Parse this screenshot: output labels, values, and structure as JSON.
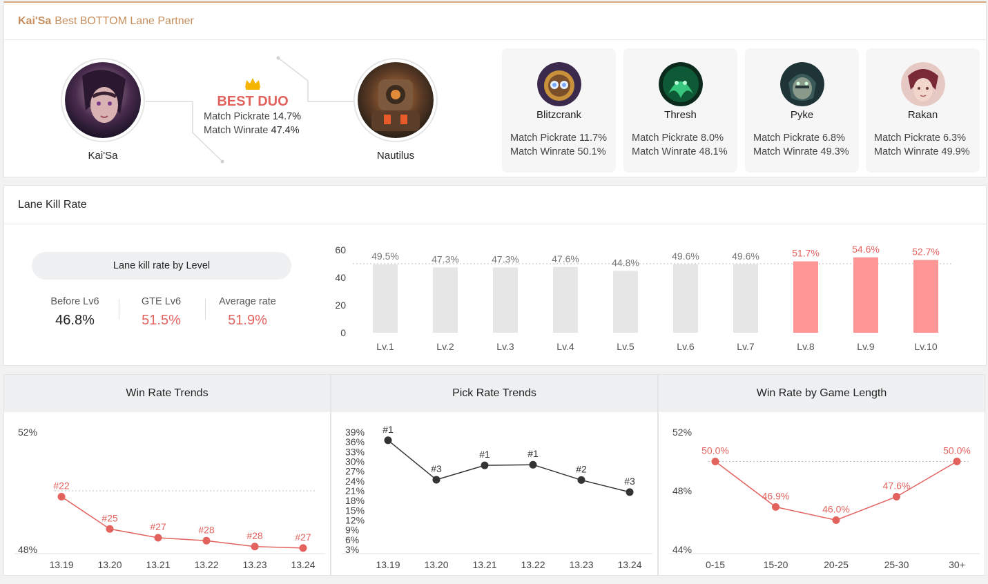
{
  "duo": {
    "title_champion": "Kai'Sa",
    "title_rest": "Best BOTTOM Lane Partner",
    "champion": "Kai'Sa",
    "partner": "Nautilus",
    "best_label": "BEST DUO",
    "pick_label": "Match Pickrate",
    "pick_value": "14.7%",
    "win_label": "Match Winrate",
    "win_value": "47.4%",
    "others": [
      {
        "name": "Blitzcrank",
        "pick_label": "Match Pickrate",
        "pick": "11.7%",
        "win_label": "Match Winrate",
        "win": "50.1%",
        "icon": "blitzcrank-portrait"
      },
      {
        "name": "Thresh",
        "pick_label": "Match Pickrate",
        "pick": "8.0%",
        "win_label": "Match Winrate",
        "win": "48.1%",
        "icon": "thresh-portrait"
      },
      {
        "name": "Pyke",
        "pick_label": "Match Pickrate",
        "pick": "6.8%",
        "win_label": "Match Winrate",
        "win": "49.3%",
        "icon": "pyke-portrait"
      },
      {
        "name": "Rakan",
        "pick_label": "Match Pickrate",
        "pick": "6.3%",
        "win_label": "Match Winrate",
        "win": "49.9%",
        "icon": "rakan-portrait"
      }
    ]
  },
  "kill": {
    "title": "Lane Kill Rate",
    "pill": "Lane kill rate by Level",
    "stats": [
      {
        "label": "Before Lv6",
        "value": "46.8%",
        "color": "#222222"
      },
      {
        "label": "GTE Lv6",
        "value": "51.5%",
        "color": "#e2625e"
      },
      {
        "label": "Average rate",
        "value": "51.9%",
        "color": "#e2625e"
      }
    ]
  },
  "colors": {
    "accent": "#e2625e",
    "bar_gray": "#e6e6e6",
    "bar_red": "#ff9696",
    "dark": "#333333",
    "brand": "#c68e5e"
  },
  "chart_data": [
    {
      "type": "bar",
      "categories": [
        "Lv.1",
        "Lv.2",
        "Lv.3",
        "Lv.4",
        "Lv.5",
        "Lv.6",
        "Lv.7",
        "Lv.8",
        "Lv.9",
        "Lv.10"
      ],
      "values": [
        49.5,
        47.3,
        47.3,
        47.6,
        44.8,
        49.6,
        49.6,
        51.7,
        54.6,
        52.7
      ],
      "labels": [
        "49.5%",
        "47.3%",
        "47.3%",
        "47.6%",
        "44.8%",
        "49.6%",
        "49.6%",
        "51.7%",
        "54.6%",
        "52.7%"
      ],
      "highlight": [
        false,
        false,
        false,
        false,
        false,
        false,
        false,
        true,
        true,
        true
      ],
      "yticks": [
        "60",
        "40",
        "20",
        "0"
      ],
      "ylim": [
        0,
        60
      ],
      "reference": 50
    },
    {
      "type": "line",
      "title": "Win Rate Trends",
      "x": [
        "13.19",
        "13.20",
        "13.21",
        "13.22",
        "13.23",
        "13.24"
      ],
      "values": [
        49.8,
        48.7,
        48.4,
        48.3,
        48.1,
        48.05
      ],
      "point_labels": [
        "#22",
        "#25",
        "#27",
        "#28",
        "#28",
        "#27"
      ],
      "yticks": [
        "52%",
        "48%"
      ],
      "ylim": [
        48,
        52
      ],
      "reference": 50
    },
    {
      "type": "line",
      "title": "Pick Rate Trends",
      "x": [
        "13.19",
        "13.20",
        "13.21",
        "13.22",
        "13.23",
        "13.24"
      ],
      "values": [
        36.5,
        24.4,
        28.8,
        29.0,
        24.3,
        20.6
      ],
      "point_labels": [
        "#1",
        "#3",
        "#1",
        "#1",
        "#2",
        "#3"
      ],
      "yticks": [
        "39%",
        "36%",
        "33%",
        "30%",
        "27%",
        "24%",
        "21%",
        "18%",
        "15%",
        "12%",
        "9%",
        "6%",
        "3%"
      ],
      "ylim": [
        3,
        39
      ]
    },
    {
      "type": "line",
      "title": "Win Rate by Game Length",
      "x": [
        "0-15",
        "15-20",
        "20-25",
        "25-30",
        "30+"
      ],
      "values": [
        50.0,
        46.9,
        46.0,
        47.6,
        50.0
      ],
      "point_labels": [
        "50.0%",
        "46.9%",
        "46.0%",
        "47.6%",
        "50.0%"
      ],
      "yticks": [
        "52%",
        "48%",
        "44%"
      ],
      "ylim": [
        44,
        52
      ],
      "reference": 50
    }
  ]
}
